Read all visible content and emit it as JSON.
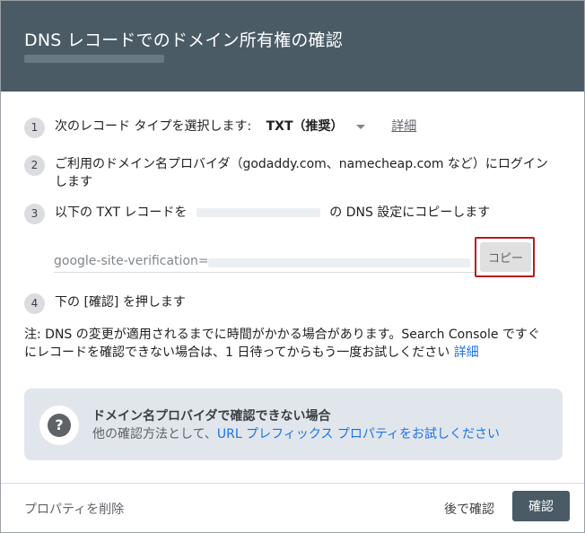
{
  "dialog": {
    "title": "DNS レコードでのドメイン所有権の確認"
  },
  "steps": [
    {
      "num": "1",
      "text": "次のレコード タイプを選択します:",
      "select_value": "TXT（推奨）",
      "detail_link": "詳細"
    },
    {
      "num": "2",
      "line1": "ご利用のドメイン名プロバイダ（godaddy.com、namecheap.com など）にログイン",
      "line2": "します"
    },
    {
      "num": "3",
      "text_before": "以下の TXT レコードを",
      "text_after": "の DNS 設定にコピーします"
    },
    {
      "num": "4",
      "text": "下の [確認] を押します"
    }
  ],
  "record": {
    "value_prefix": "google-site-verification=",
    "copy_label": "コピー"
  },
  "note": {
    "line1": "注: DNS の変更が適用されるまでに時間がかかる場合があります。Search Console ですぐ",
    "line2": "にレコードを確認できない場合は、1 日待ってからもう一度お試しください ",
    "link": "詳細"
  },
  "help": {
    "icon": "question-icon",
    "title": "ドメイン名プロバイダで確認できない場合",
    "text": "他の確認方法として、",
    "link": "URL プレフィックス プロパティをお試しください"
  },
  "footer": {
    "delete_label": "プロパティを削除",
    "later_label": "後で確認",
    "confirm_label": "確認"
  },
  "colors": {
    "header_bg": "#4a5b66",
    "link": "#1a73e8",
    "highlight": "#b71c1c"
  }
}
